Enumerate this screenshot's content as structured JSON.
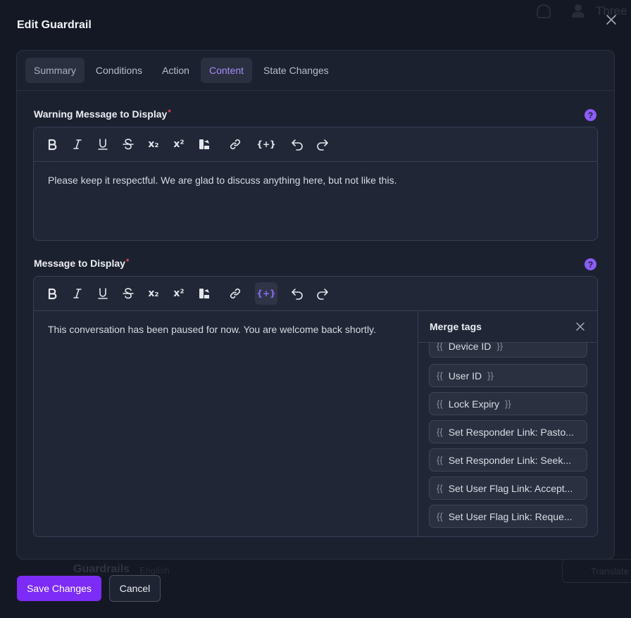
{
  "background": {
    "user_name": "Three",
    "section_title": "Guardrails",
    "language": "English",
    "translate_label": "Translate"
  },
  "modal": {
    "title": "Edit Guardrail",
    "tabs": [
      {
        "label": "Summary"
      },
      {
        "label": "Conditions"
      },
      {
        "label": "Action"
      },
      {
        "label": "Content"
      },
      {
        "label": "State Changes"
      }
    ],
    "active_tab": "Content"
  },
  "fields": {
    "warning": {
      "label": "Warning Message to Display",
      "required_mark": "*",
      "content": "Please keep it respectful. We are glad to discuss anything here, but not like this."
    },
    "message": {
      "label": "Message to Display",
      "required_mark": "*",
      "content": "This conversation has been paused for now. You are welcome back shortly."
    }
  },
  "help_icon_glyph": "?",
  "toolbar": {
    "subscript_label": "x₂",
    "superscript_label": "x²",
    "merge_tag_label": "{+}"
  },
  "merge_tags": {
    "title": "Merge tags",
    "open_brace": "{{",
    "close_brace": "}}",
    "items": [
      {
        "name": "Device ID"
      },
      {
        "name": "User ID"
      },
      {
        "name": "Lock Expiry"
      },
      {
        "name": "Set Responder Link: Pasto..."
      },
      {
        "name": "Set Responder Link: Seek..."
      },
      {
        "name": "Set User Flag Link: Accept..."
      },
      {
        "name": "Set User Flag Link: Reque..."
      }
    ]
  },
  "footer": {
    "save_label": "Save Changes",
    "cancel_label": "Cancel"
  },
  "colors": {
    "accent": "#7c2cf6",
    "accent_text": "#a78bfa",
    "background": "#141824",
    "panel": "#1c2130",
    "required": "#f05252"
  }
}
